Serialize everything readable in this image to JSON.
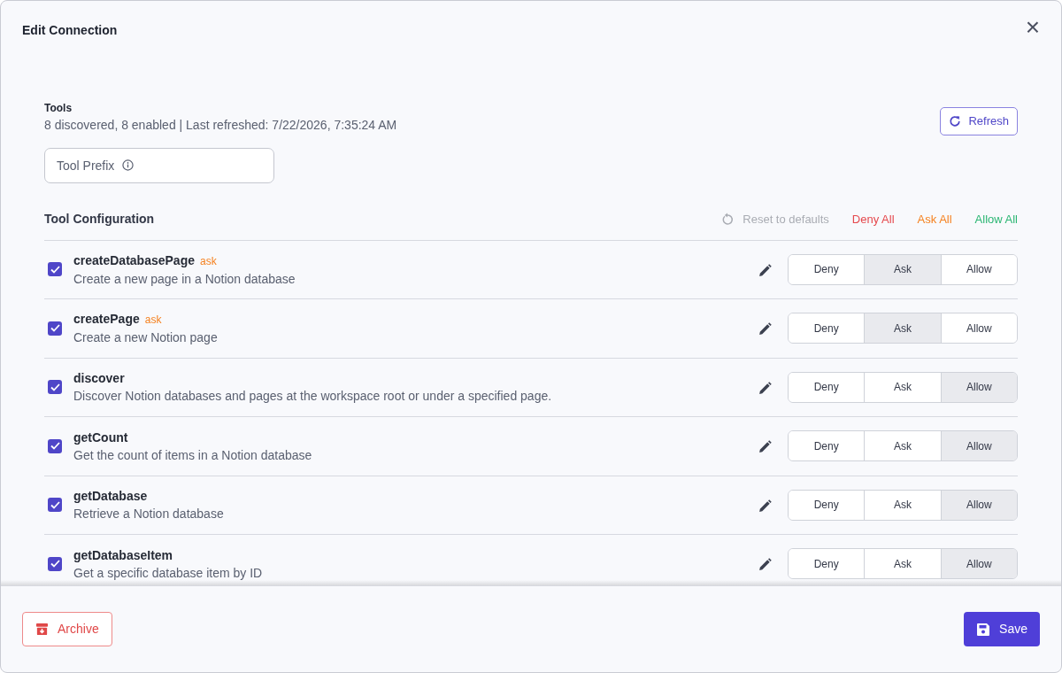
{
  "dialog": {
    "title": "Edit Connection",
    "close": "×"
  },
  "tools_section": {
    "title": "Tools",
    "summary": "8 discovered, 8 enabled | Last refreshed: 7/22/2026, 7:35:24 AM",
    "refresh": "Refresh"
  },
  "prefix_field": {
    "placeholder": "Tool Prefix"
  },
  "configuration": {
    "title": "Tool Configuration",
    "reset": "Reset to defaults",
    "reset_disabled": true,
    "bulk_actions": [
      {
        "label": "Deny All",
        "color": "#e5484d"
      },
      {
        "label": "Ask All",
        "color": "#f5811f"
      },
      {
        "label": "Allow All",
        "color": "#2bb673"
      }
    ]
  },
  "tools": [
    {
      "name": "createDatabasePage",
      "badge": "ask",
      "description": "Create a new page in a Notion database",
      "checked": true,
      "options": [
        {
          "label": "Deny",
          "selected": false
        },
        {
          "label": "Ask",
          "selected": true
        },
        {
          "label": "Allow",
          "selected": false
        }
      ]
    },
    {
      "name": "createPage",
      "badge": "ask",
      "description": "Create a new Notion page",
      "checked": true,
      "options": [
        {
          "label": "Deny",
          "selected": false
        },
        {
          "label": "Ask",
          "selected": true
        },
        {
          "label": "Allow",
          "selected": false
        }
      ]
    },
    {
      "name": "discover",
      "description": "Discover Notion databases and pages at the workspace root or under a specified page.",
      "checked": true,
      "options": [
        {
          "label": "Deny",
          "selected": false
        },
        {
          "label": "Ask",
          "selected": false
        },
        {
          "label": "Allow",
          "selected": true
        }
      ]
    },
    {
      "name": "getCount",
      "description": "Get the count of items in a Notion database",
      "checked": true,
      "options": [
        {
          "label": "Deny",
          "selected": false
        },
        {
          "label": "Ask",
          "selected": false
        },
        {
          "label": "Allow",
          "selected": true
        }
      ]
    },
    {
      "name": "getDatabase",
      "description": "Retrieve a Notion database",
      "checked": true,
      "options": [
        {
          "label": "Deny",
          "selected": false
        },
        {
          "label": "Ask",
          "selected": false
        },
        {
          "label": "Allow",
          "selected": true
        }
      ]
    },
    {
      "name": "getDatabaseItem",
      "description": "Get a specific database item by ID",
      "checked": true,
      "options": [
        {
          "label": "Deny",
          "selected": false
        },
        {
          "label": "Ask",
          "selected": false
        },
        {
          "label": "Allow",
          "selected": true
        }
      ]
    }
  ],
  "footer": {
    "archive": "Archive",
    "save": "Save"
  }
}
